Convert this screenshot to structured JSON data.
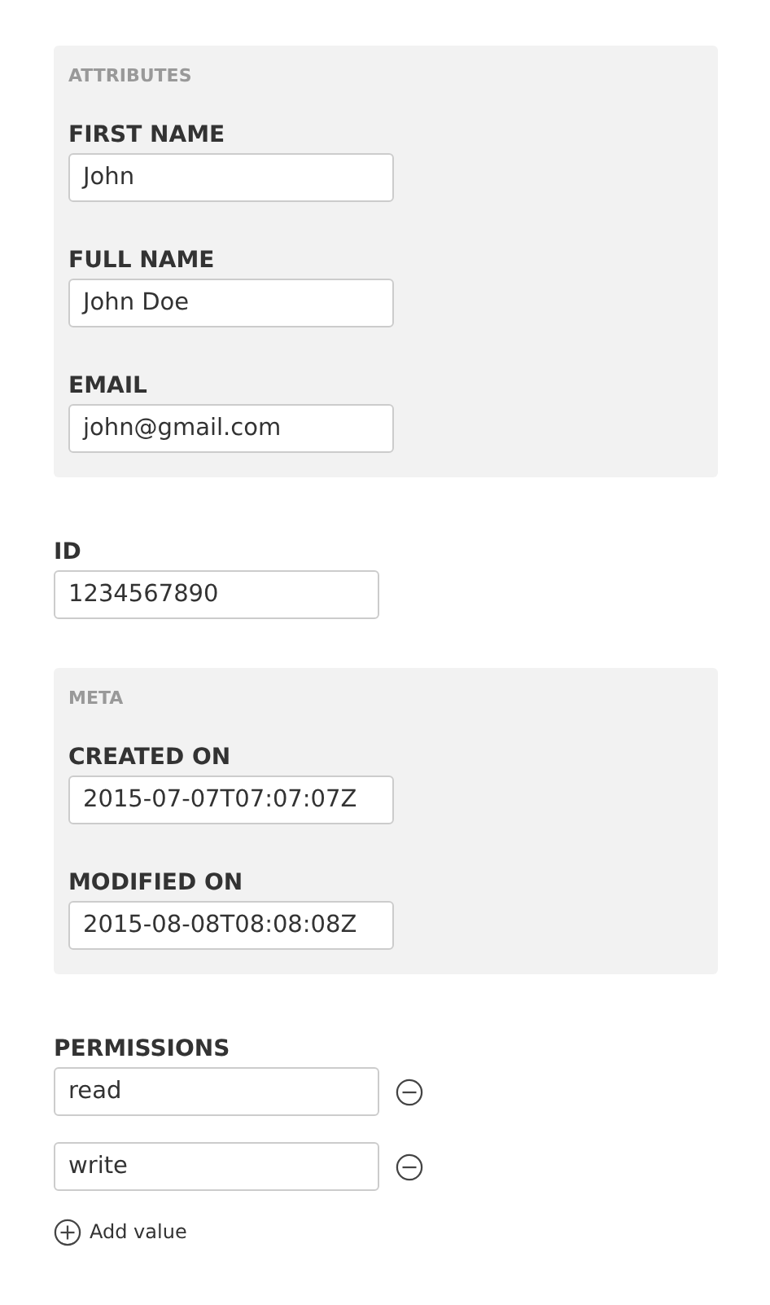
{
  "sections": [
    {
      "kind": "group",
      "title": "ATTRIBUTES",
      "fields": [
        {
          "label": "FIRST NAME",
          "value": "John"
        },
        {
          "label": "FULL NAME",
          "value": "John Doe"
        },
        {
          "label": "EMAIL",
          "value": "john@gmail.com"
        }
      ]
    },
    {
      "kind": "field",
      "label": "ID",
      "value": "1234567890"
    },
    {
      "kind": "group",
      "title": "META",
      "fields": [
        {
          "label": "CREATED ON",
          "value": "2015-07-07T07:07:07Z"
        },
        {
          "label": "MODIFIED ON",
          "value": "2015-08-08T08:08:08Z"
        }
      ]
    },
    {
      "kind": "list",
      "label": "PERMISSIONS",
      "values": [
        "read",
        "write"
      ],
      "add_label": "Add value"
    }
  ]
}
